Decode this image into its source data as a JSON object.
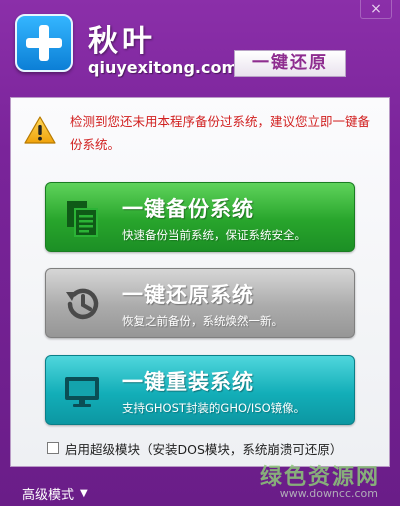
{
  "header": {
    "brand_cn": "秋叶",
    "brand_en": "qiuyexitong.com",
    "restore_badge": "一键还原",
    "close_label": "×"
  },
  "warning": {
    "text": "检测到您还未用本程序备份过系统，建议您立即一键备份系统。"
  },
  "actions": [
    {
      "title": "一键备份系统",
      "subtitle": "快速备份当前系统，保证系统安全。",
      "icon": "document-copy-icon"
    },
    {
      "title": "一键还原系统",
      "subtitle": "恢复之前备份，系统焕然一新。",
      "icon": "history-clock-icon"
    },
    {
      "title": "一键重装系统",
      "subtitle": "支持GHOST封装的GHO/ISO镜像。",
      "icon": "monitor-icon"
    }
  ],
  "super_mode": {
    "label": "启用超级模块（安装DOS模块，系统崩溃可还原）",
    "checked": false
  },
  "footer": {
    "advanced_label": "高级模式",
    "watermark_cn": "绿色资源网",
    "watermark_en": "www.downcc.com"
  },
  "colors": {
    "brand_purple": "#7a249a",
    "backup_green": "#28a52c",
    "restore_gray": "#ababab",
    "reinstall_teal": "#13aeb8",
    "warning_red": "#d11f1f"
  }
}
